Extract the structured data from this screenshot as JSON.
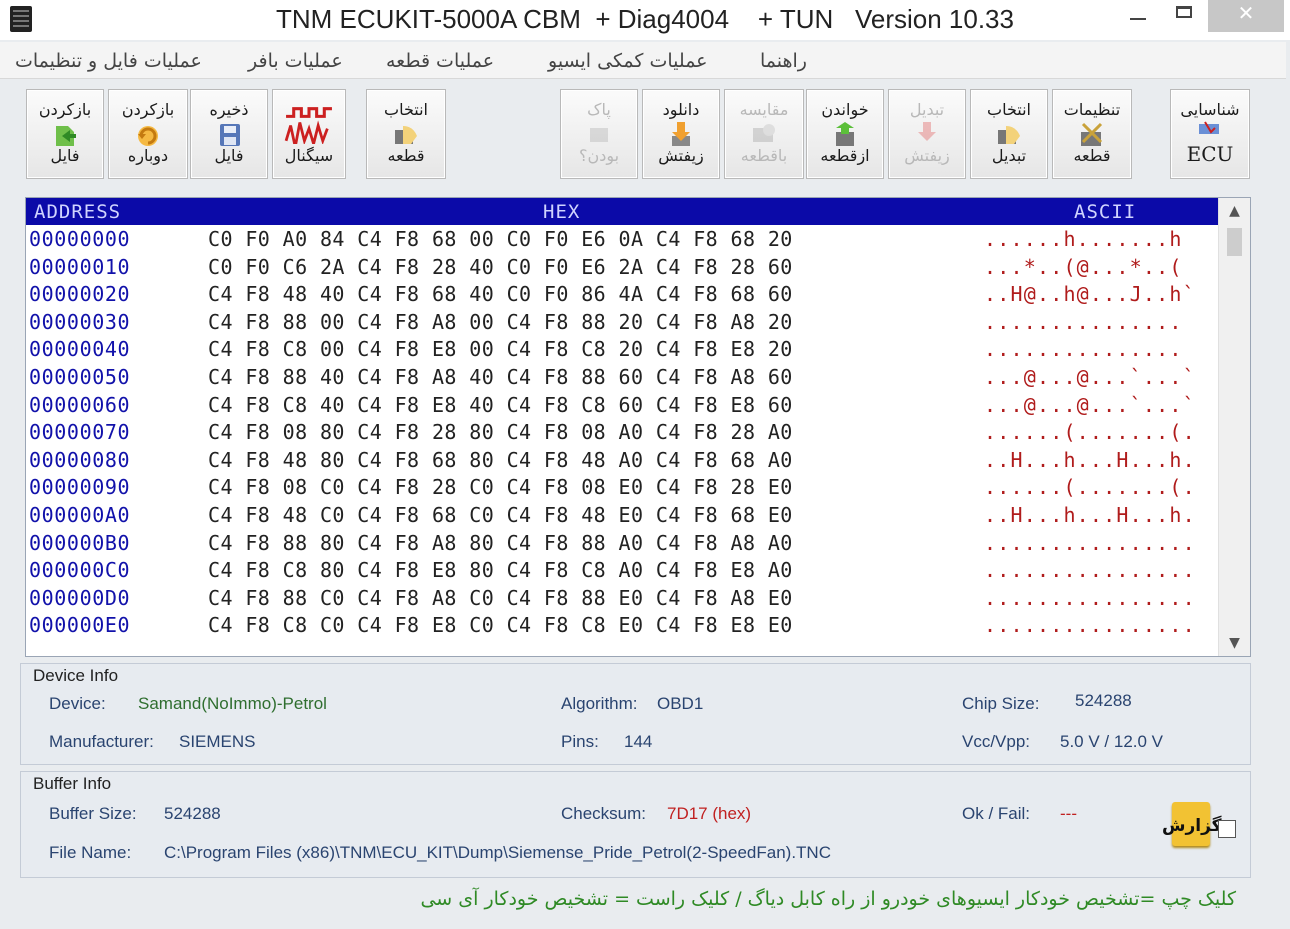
{
  "window": {
    "title": "TNM ECUKIT-5000A CBM  + Diag4004    + TUN   Version 10.33",
    "minimize_label": "",
    "close_label": "✕"
  },
  "menu": [
    "عملیات فایل و تنظیمات",
    "عملیات بافر",
    "عملیات قطعه",
    "عملیات کمکی ایسیو",
    "راهنما"
  ],
  "toolbar": {
    "reload_file": {
      "line1": "بازکردن",
      "line2": "فایل"
    },
    "reopen": {
      "line1": "بازکردن",
      "line2": "دوباره"
    },
    "save_file": {
      "line1": "ذخیره",
      "line2": "فایل"
    },
    "signal": {
      "line1": "",
      "line2": "سیگنال"
    },
    "select_part": {
      "line1": "انتخاب",
      "line2": "قطعه"
    },
    "blank_check": {
      "line1": "پاک",
      "line2": "بودن؟"
    },
    "download_ziftesh": {
      "line1": "دانلود",
      "line2": "زیفتش"
    },
    "compare": {
      "line1": "مقایسه",
      "line2": "باقطعه"
    },
    "read_part": {
      "line1": "خواندن",
      "line2": "ازقطعه"
    },
    "convert_ziftesh": {
      "line1": "تبدیل",
      "line2": "زیفتش"
    },
    "select_convert": {
      "line1": "انتخاب",
      "line2": "تبدیل"
    },
    "part_settings": {
      "line1": "تنظیمات",
      "line2": "قطعه"
    },
    "identify_ecu": {
      "line1": "شناسایی",
      "line2": "ECU"
    }
  },
  "hex_view": {
    "header": {
      "address": "ADDRESS",
      "hex": "HEX",
      "ascii": "ASCII"
    },
    "rows": [
      {
        "addr": "00000000",
        "hex": "C0 F0 A0 84 C4 F8 68 00 C0 F0 E6 0A C4 F8 68 20",
        "ascii": "......h.......h"
      },
      {
        "addr": "00000010",
        "hex": "C0 F0 C6 2A C4 F8 28 40 C0 F0 E6 2A C4 F8 28 60",
        "ascii": "...*..(@...*..("
      },
      {
        "addr": "00000020",
        "hex": "C4 F8 48 40 C4 F8 68 40 C0 F0 86 4A C4 F8 68 60",
        "ascii": "..H@..h@...J..h`"
      },
      {
        "addr": "00000030",
        "hex": "C4 F8 88 00 C4 F8 A8 00 C4 F8 88 20 C4 F8 A8 20",
        "ascii": "............... "
      },
      {
        "addr": "00000040",
        "hex": "C4 F8 C8 00 C4 F8 E8 00 C4 F8 C8 20 C4 F8 E8 20",
        "ascii": "............... "
      },
      {
        "addr": "00000050",
        "hex": "C4 F8 88 40 C4 F8 A8 40 C4 F8 88 60 C4 F8 A8 60",
        "ascii": "...@...@...`...`"
      },
      {
        "addr": "00000060",
        "hex": "C4 F8 C8 40 C4 F8 E8 40 C4 F8 C8 60 C4 F8 E8 60",
        "ascii": "...@...@...`...`"
      },
      {
        "addr": "00000070",
        "hex": "C4 F8 08 80 C4 F8 28 80 C4 F8 08 A0 C4 F8 28 A0",
        "ascii": "......(.......(."
      },
      {
        "addr": "00000080",
        "hex": "C4 F8 48 80 C4 F8 68 80 C4 F8 48 A0 C4 F8 68 A0",
        "ascii": "..H...h...H...h."
      },
      {
        "addr": "00000090",
        "hex": "C4 F8 08 C0 C4 F8 28 C0 C4 F8 08 E0 C4 F8 28 E0",
        "ascii": "......(.......(."
      },
      {
        "addr": "000000A0",
        "hex": "C4 F8 48 C0 C4 F8 68 C0 C4 F8 48 E0 C4 F8 68 E0",
        "ascii": "..H...h...H...h."
      },
      {
        "addr": "000000B0",
        "hex": "C4 F8 88 80 C4 F8 A8 80 C4 F8 88 A0 C4 F8 A8 A0",
        "ascii": "................"
      },
      {
        "addr": "000000C0",
        "hex": "C4 F8 C8 80 C4 F8 E8 80 C4 F8 C8 A0 C4 F8 E8 A0",
        "ascii": "................"
      },
      {
        "addr": "000000D0",
        "hex": "C4 F8 88 C0 C4 F8 A8 C0 C4 F8 88 E0 C4 F8 A8 E0",
        "ascii": "................"
      },
      {
        "addr": "000000E0",
        "hex": "C4 F8 C8 C0 C4 F8 E8 C0 C4 F8 C8 E0 C4 F8 E8 E0",
        "ascii": "................"
      }
    ]
  },
  "device_info": {
    "title": "Device Info",
    "device_label": "Device:",
    "device_value": "Samand(NoImmo)-Petrol",
    "algorithm_label": "Algorithm:",
    "algorithm_value": "OBD1",
    "chip_size_label": "Chip Size:",
    "chip_size_value": "524288",
    "manufacturer_label": "Manufacturer:",
    "manufacturer_value": "SIEMENS",
    "pins_label": "Pins:",
    "pins_value": "144",
    "vcc_label": "Vcc/Vpp:",
    "vcc_value": "5.0 V / 12.0 V"
  },
  "buffer_info": {
    "title": "Buffer Info",
    "buffer_size_label": "Buffer Size:",
    "buffer_size_value": "524288",
    "checksum_label": "Checksum:",
    "checksum_value": "7D17 (hex)",
    "okfail_label": "Ok / Fail:",
    "okfail_value": "---",
    "filename_label": "File Name:",
    "filename_value": "C:\\Program Files (x86)\\TNM\\ECU_KIT\\Dump\\Siemense_Pride_Petrol(2-SpeedFan).TNC",
    "report_label": "گزارش"
  },
  "footer": "کلیک چپ =تشخیص خودکار ایسیوهای خودرو از راه کابل دیاگ /   کلیک راست = تشخیص خودکار آی سی",
  "colors": {
    "hex_header_bg": "#0b0aa8",
    "address_text": "#1111aa",
    "ascii_text": "#b01c1c",
    "footer_text": "#2f8a25",
    "device_value": "#2f6e2f",
    "checksum_value": "#c02020"
  },
  "icons": [
    "app-chip-icon",
    "open-file-icon",
    "reload-icon",
    "save-icon",
    "signal-wave-icon",
    "select-chip-icon",
    "blank-eraser-icon",
    "download-arrow-icon",
    "compare-icon",
    "read-chip-icon",
    "convert-icon",
    "select-convert-icon",
    "settings-tools-icon",
    "ecu-identify-icon",
    "notepad-icon"
  ]
}
